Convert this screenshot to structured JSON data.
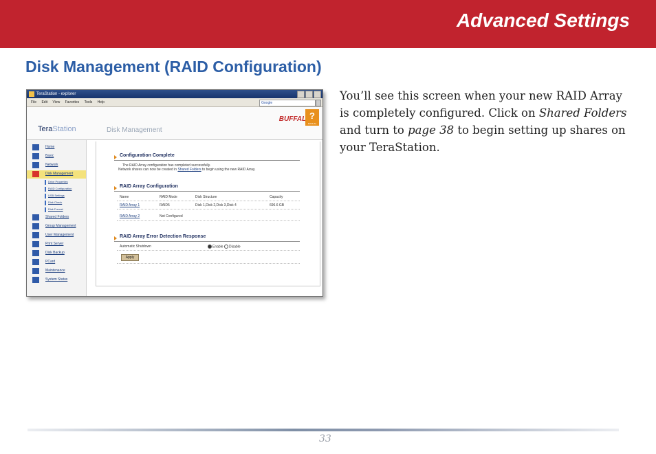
{
  "banner": {
    "title": "Advanced Settings"
  },
  "section": {
    "heading": "Disk Management (RAID Configuration)"
  },
  "body": {
    "p1": "You’ll see this screen when your new RAID Array is completely configured.  Click on ",
    "em1": "Shared Folders",
    "p2": " and turn to ",
    "em2": "page 38",
    "p3": " to begin setting up shares on your TeraStation."
  },
  "screenshot": {
    "window_title": "TeraStation - explorer",
    "menus": [
      "File",
      "Edit",
      "View",
      "Favorites",
      "Tools",
      "Help"
    ],
    "search_label": "Google",
    "brand_prefix": "Tera",
    "brand_suffix": "Station",
    "vendor_logo": "BUFFALO",
    "help_label": "?",
    "help_caption": "MANUAL",
    "page_title": "Disk Management",
    "nav": {
      "home": "Home",
      "basic": "Basic",
      "network": "Network",
      "disk_management": "Disk Management",
      "disk_properties": "Drive Properties",
      "raid_configuration": "RAID Configuration",
      "usb_settings": "USB Settings",
      "disk_check": "Disk Check",
      "disk_format": "Disk Format",
      "shared_folders": "Shared Folders",
      "group_management": "Group Management",
      "user_management": "User Management",
      "print_server": "Print Server",
      "disk_backup": "Disk Backup",
      "pc_card": "PCard",
      "maintenance": "Maintenance",
      "system_status": "System Status"
    },
    "config_complete": {
      "title": "Configuration Complete",
      "line1": "The RAID Array configuration has completed successfully.",
      "line2_a": "Network shares can now be created in ",
      "line2_link": "Shared Folders",
      "line2_b": " to begin using the new RAID Array."
    },
    "raid_table": {
      "title": "RAID Array Configuration",
      "headers": [
        "Name",
        "RAID Mode",
        "Disk Structure",
        "Capacity"
      ],
      "rows": [
        [
          "RAID Array 1",
          "RAID5",
          "Disk 1,Disk 2,Disk 3,Disk 4",
          "696.6 GB"
        ],
        [
          "RAID Array 2",
          "Not Configured",
          "",
          ""
        ]
      ]
    },
    "error_response": {
      "title": "RAID Array Error Detection Response",
      "label": "Automatic Shutdown",
      "opt_enable": "Enable",
      "opt_disable": "Disable",
      "apply": "Apply"
    }
  },
  "footer": {
    "page_number": "33"
  }
}
